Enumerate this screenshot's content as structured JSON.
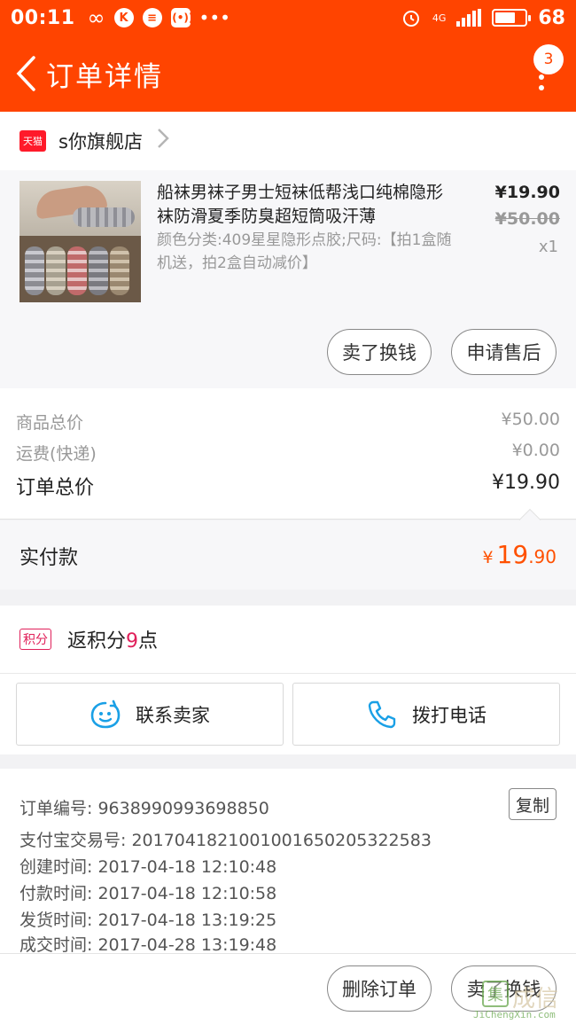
{
  "status_bar": {
    "time": "00:11",
    "network": "4G",
    "battery": "68",
    "battery_level": 0.68,
    "icons": [
      "infinity-icon",
      "k-app-icon",
      "chat-app-icon",
      "signal-app-icon",
      "more-dots-icon",
      "alarm-icon",
      "signal-bars-icon",
      "battery-icon"
    ]
  },
  "header": {
    "title": "订单详情",
    "badge_count": "3"
  },
  "shop": {
    "badge": "天猫",
    "name": "s你旗舰店"
  },
  "product": {
    "name": "船袜男袜子男士短袜低帮浅口纯棉隐形袜防滑夏季防臭超短筒吸汗薄",
    "spec": "颜色分类:409星星隐形点胶;尺码:【拍1盒随机送，拍2盒自动减价】",
    "price": "¥19.90",
    "original_price": "¥50.00",
    "quantity": "x1",
    "actions": [
      "卖了换钱",
      "申请售后"
    ]
  },
  "summary": {
    "rows": [
      {
        "label": "商品总价",
        "value": "¥50.00"
      },
      {
        "label": "运费(快递)",
        "value": "¥0.00"
      },
      {
        "label": "订单总价",
        "value": "¥19.90"
      }
    ]
  },
  "paid": {
    "label": "实付款",
    "currency": "¥",
    "integer": "19",
    "decimal": ".90"
  },
  "points": {
    "badge": "积分",
    "prefix": "返积分",
    "number": "9",
    "suffix": "点"
  },
  "contact": {
    "seller": "联系卖家",
    "call": "拨打电话"
  },
  "order_info": {
    "copy_label": "复制",
    "lines": [
      "订单编号: 9638990993698850",
      "支付宝交易号: 2017041821001001650205322583",
      "创建时间: 2017-04-18 12:10:48",
      "付款时间: 2017-04-18 12:10:58",
      "发货时间: 2017-04-18 13:19:25",
      "成交时间: 2017-04-28 13:19:48"
    ]
  },
  "bottom_actions": [
    "删除订单",
    "卖了换钱"
  ],
  "watermark": {
    "mark": "集",
    "text": "JiChengXin.com"
  },
  "colors": {
    "brand": "#ff4400",
    "price_accent": "#ff5000",
    "points_accent": "#e0205a"
  }
}
